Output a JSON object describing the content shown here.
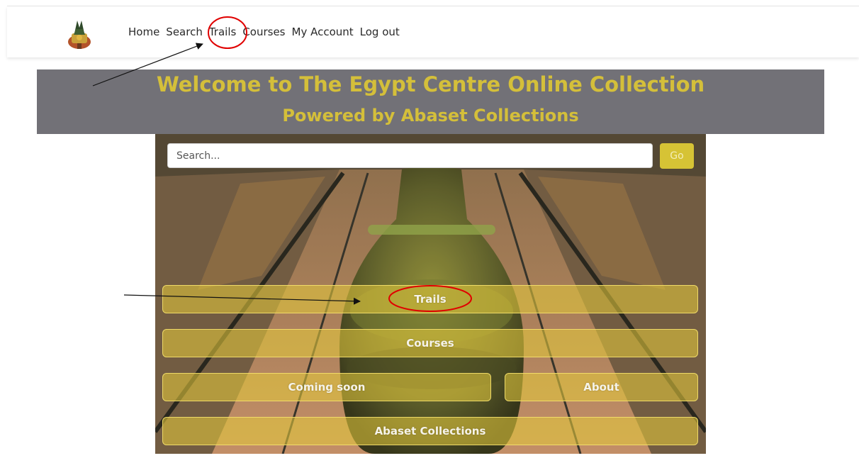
{
  "nav": {
    "logo_icon": "anubis-logo-icon",
    "links": [
      "Home",
      "Search",
      "Trails",
      "Courses",
      "My Account",
      "Log out"
    ]
  },
  "banner": {
    "title": "Welcome to The Egypt Centre Online Collection",
    "subtitle": "Powered by Abaset Collections"
  },
  "search": {
    "placeholder": "Search...",
    "go_label": "Go"
  },
  "menu": {
    "trails": "Trails",
    "courses": "Courses",
    "coming_soon": "Coming soon",
    "about": "About",
    "abaset": "Abaset Collections"
  },
  "colors": {
    "banner_bg": "#727177",
    "banner_text": "#d4bf3a",
    "button_yellow": "#d6c335",
    "annotation_red": "#e00000"
  }
}
